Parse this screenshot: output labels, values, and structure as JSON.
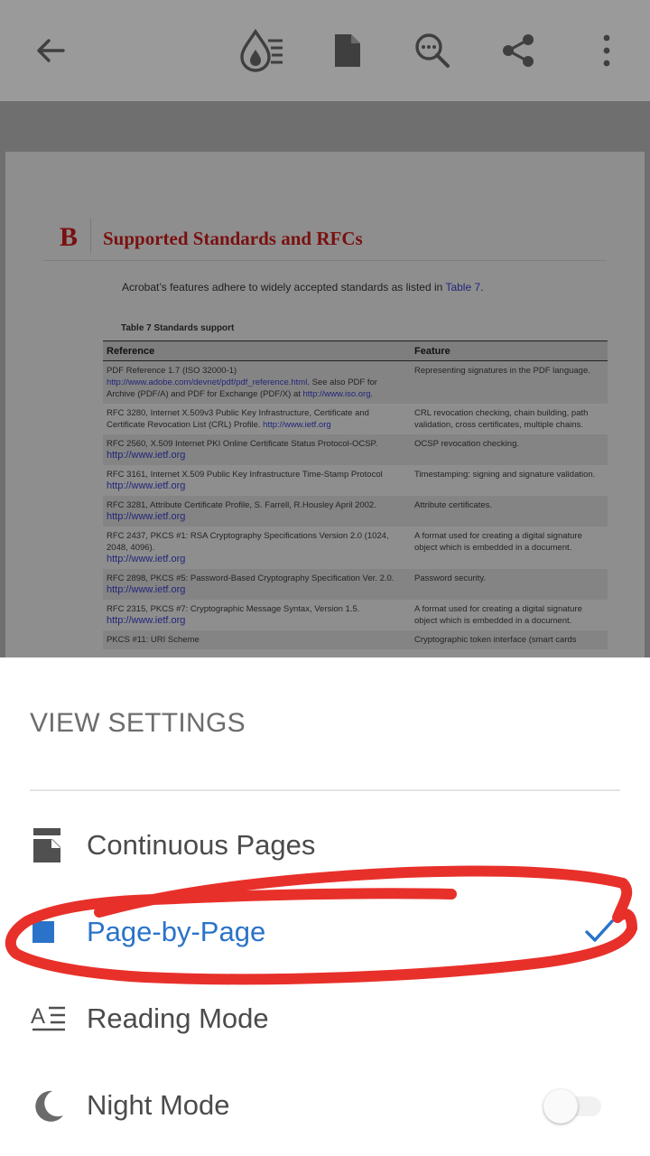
{
  "toolbar": {
    "icons": [
      "back-arrow-icon",
      "liquid-mode-icon",
      "page-icon",
      "search-icon",
      "share-icon",
      "more-options-icon"
    ]
  },
  "document": {
    "appendix_letter": "B",
    "title": "Supported Standards and RFCs",
    "intro_text": "Acrobat’s features adhere to widely accepted standards as listed in ",
    "intro_ref": "Table 7",
    "intro_end": ".",
    "table_caption": "Table 7  Standards support",
    "table": {
      "headers": [
        "Reference",
        "Feature"
      ],
      "rows": [
        {
          "ref_a": "PDF Reference 1.7 (ISO 32000-1) ",
          "ref_link": "http://www.adobe.com/devnet/pdf/pdf_reference.html",
          "ref_b": ". See also PDF for Archive (PDF/A) and PDF for Exchange (PDF/X) at ",
          "ref_link2": "http://www.iso.org",
          "ref_c": ".",
          "feature": "Representing signatures in the PDF language."
        },
        {
          "ref_a": "RFC 3280, Internet X.509v3 Public Key Infrastructure, Certificate and Certificate Revocation List (CRL) Profile. ",
          "ref_link": "http://www.ietf.org",
          "feature": "CRL revocation checking, chain building, path validation, cross certificates, multiple chains."
        },
        {
          "ref_a": "RFC 2560, X.509 Internet PKI Online Certificate Status Protocol-OCSP.",
          "ref_link": "http://www.ietf.org",
          "feature": "OCSP revocation checking."
        },
        {
          "ref_a": "RFC 3161, Internet X.509 Public Key Infrastructure Time-Stamp Protocol",
          "ref_link": "http://www.ietf.org",
          "feature": "Timestamping: signing and signature validation."
        },
        {
          "ref_a": "RFC 3281, Attribute Certificate Profile, S. Farrell, R.Housley April 2002.",
          "ref_link": "http://www.ietf.org",
          "feature": "Attribute certificates."
        },
        {
          "ref_a": "RFC 2437, PKCS #1: RSA Cryptography Specifications Version 2.0 (1024, 2048, 4096).",
          "ref_link": "http://www.ietf.org",
          "feature": "A format used for creating a digital signature object which is embedded in a document."
        },
        {
          "ref_a": "RFC 2898, PKCS #5: Password-Based Cryptography Specification Ver. 2.0.",
          "ref_link": "http://www.ietf.org",
          "feature": "Password security."
        },
        {
          "ref_a": "RFC 2315, PKCS #7: Cryptographic Message Syntax, Version 1.5.",
          "ref_link": "http://www.ietf.org",
          "feature": "A format used for creating a digital signature object which is embedded in a document."
        },
        {
          "ref_a": "PKCS #11: URI Scheme",
          "ref_link": "",
          "feature": "Cryptographic token interface (smart cards"
        }
      ]
    }
  },
  "view_settings": {
    "heading": "VIEW SETTINGS",
    "options": [
      {
        "label": "Continuous Pages",
        "icon": "continuous-pages-icon",
        "selected": false
      },
      {
        "label": "Page-by-Page",
        "icon": "page-by-page-icon",
        "selected": true
      },
      {
        "label": "Reading Mode",
        "icon": "reading-mode-icon",
        "selected": false
      },
      {
        "label": "Night Mode",
        "icon": "moon-icon",
        "toggle_on": false
      }
    ]
  },
  "colors": {
    "accent": "#2a73c9",
    "annotation_red": "#e8302a",
    "document_title": "#7a1010"
  }
}
